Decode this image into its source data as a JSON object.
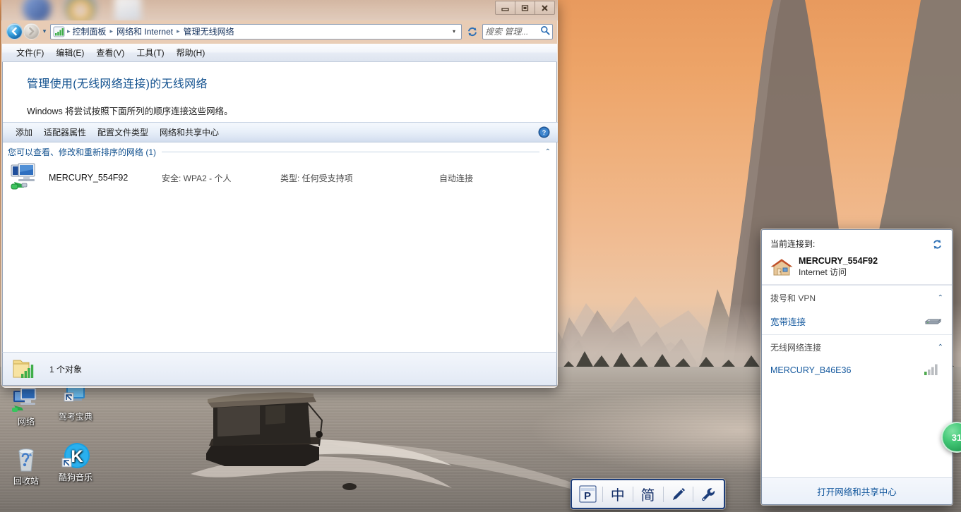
{
  "window": {
    "title": "管理无线网络",
    "controls": {
      "minimize": "最小化",
      "restore": "还原",
      "close": "关闭"
    },
    "address": {
      "crumbs": [
        "控制面板",
        "网络和 Internet",
        "管理无线网络"
      ],
      "separator": "▸",
      "dropdown_glyph": "▾",
      "recent_glyph": "▾"
    },
    "search": {
      "placeholder": "搜索 管理...",
      "value": ""
    },
    "menubar": [
      "文件(F)",
      "编辑(E)",
      "查看(V)",
      "工具(T)",
      "帮助(H)"
    ],
    "header": {
      "title": "管理使用(无线网络连接)的无线网络",
      "subtitle": "Windows 将尝试按照下面所列的顺序连接这些网络。"
    },
    "commandbar": {
      "items": [
        "添加",
        "适配器属性",
        "配置文件类型",
        "网络和共享中心"
      ],
      "help_label": "?"
    },
    "section": {
      "label": "您可以查看、修改和重新排序的网络 (1)",
      "chevron": "⌃"
    },
    "networks": [
      {
        "name": "MERCURY_554F92",
        "security": "安全: WPA2 - 个人",
        "type": "类型: 任何受支持项",
        "autoconnect": "自动连接"
      }
    ],
    "statusbar": {
      "text": "1 个对象"
    }
  },
  "flyout": {
    "current_label": "当前连接到:",
    "refresh_title": "刷新",
    "current": {
      "ssid": "MERCURY_554F92",
      "access": "Internet 访问"
    },
    "groups": [
      {
        "title": "拨号和 VPN",
        "chevron": "⌃",
        "items": [
          {
            "name": "宽带连接",
            "icon": "modem-icon"
          }
        ]
      },
      {
        "title": "无线网络连接",
        "chevron": "⌃",
        "items": [
          {
            "name": "MERCURY_B46E36",
            "icon": "signal-bars-icon"
          }
        ]
      }
    ],
    "footer_link": "打开网络和共享中心"
  },
  "desktop": {
    "icons": [
      {
        "label": "网络",
        "icon": "network-icon",
        "shortcut": false
      },
      {
        "label": "驾考宝典",
        "icon": "app-icon",
        "shortcut": true
      },
      {
        "label": "回收站",
        "icon": "recycle-bin-icon",
        "shortcut": false
      },
      {
        "label": "酷狗音乐",
        "icon": "kugou-icon",
        "shortcut": true
      }
    ]
  },
  "ime": {
    "cells": [
      {
        "label": "P",
        "name": "ime-logo-icon"
      },
      {
        "label": "中",
        "name": "ime-chinese-mode"
      },
      {
        "label": "简",
        "name": "ime-simplified-mode"
      },
      {
        "label": "✏",
        "name": "ime-handwriting-icon"
      },
      {
        "label": "🔧",
        "name": "ime-settings-icon"
      }
    ]
  },
  "badge": {
    "count": "31"
  },
  "colors": {
    "accent_blue": "#15599e",
    "title_blue": "#12518f",
    "link_blue": "#15599e",
    "sky_orange": "#eda468",
    "badge_green": "#2ba85c"
  }
}
